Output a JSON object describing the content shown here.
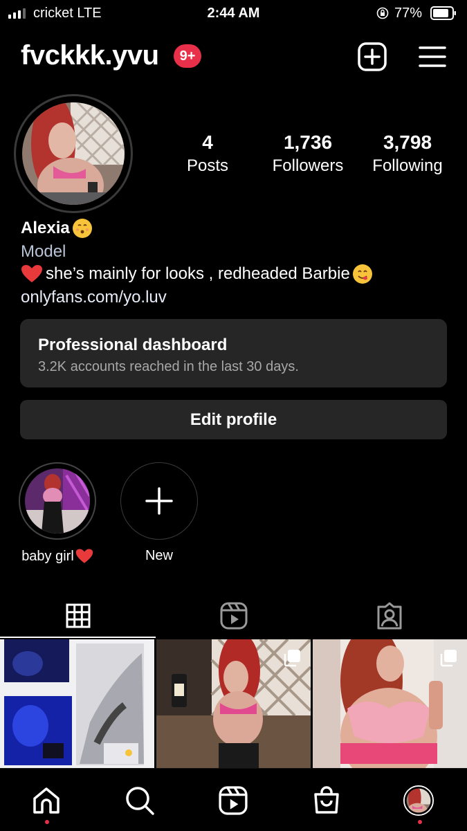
{
  "status_bar": {
    "carrier": "cricket  LTE",
    "time": "2:44 AM",
    "battery": "77%"
  },
  "header": {
    "username": "fvckkk.yvu",
    "notification_badge": "9+",
    "icons": [
      "plus-square-icon",
      "hamburger-menu-icon"
    ]
  },
  "stats": {
    "posts": {
      "value": "4",
      "label": "Posts"
    },
    "followers": {
      "value": "1,736",
      "label": "Followers"
    },
    "following": {
      "value": "3,798",
      "label": "Following"
    }
  },
  "bio": {
    "name": "Alexia",
    "category": "Model",
    "text": "she’s mainly for looks , redheaded Barbie",
    "link": "onlyfans.com/yo.luv"
  },
  "dashboard": {
    "title": "Professional dashboard",
    "subtitle": "3.2K accounts reached in the last 30 days."
  },
  "edit_profile": "Edit profile",
  "highlights": [
    {
      "label": "baby girl"
    },
    {
      "label": "New"
    }
  ],
  "tabs": [
    "grid-icon",
    "reels-icon",
    "tagged-icon"
  ],
  "bottom_nav": [
    "home-icon",
    "search-icon",
    "reels-icon",
    "shop-icon",
    "profile-avatar"
  ],
  "colors": {
    "background": "#000000",
    "card": "#262626",
    "badge": "#e8304a",
    "category_text": "#b9c4d6"
  }
}
